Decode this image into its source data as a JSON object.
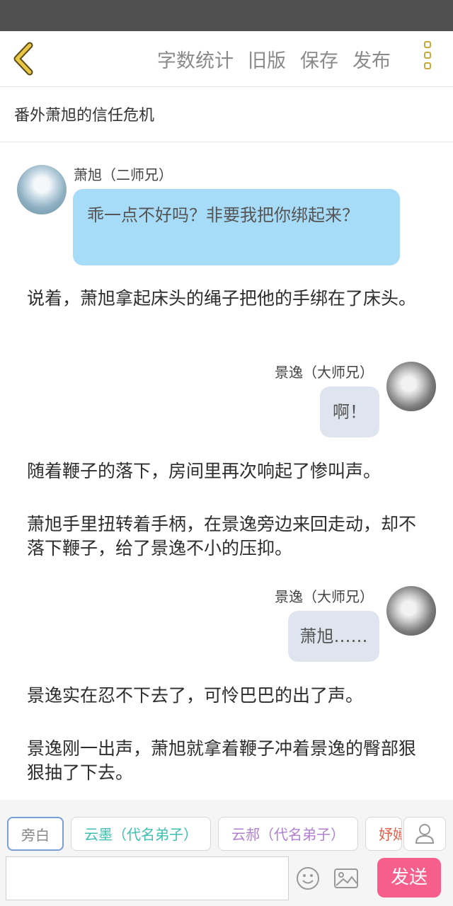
{
  "toolbar": {
    "word_count": "字数统计",
    "old_version": "旧版",
    "save": "保存",
    "publish": "发布"
  },
  "chapter": {
    "title": "番外萧旭的信任危机"
  },
  "messages": [
    {
      "type": "dialog",
      "speaker": "萧旭（二师兄）",
      "text": "乖一点不好吗？非要我把你绑起来？"
    },
    {
      "type": "narration",
      "text": "说着，萧旭拿起床头的绳子把他的手绑在了床头。"
    },
    {
      "type": "dialog",
      "speaker": "景逸（大师兄）",
      "text": "啊！"
    },
    {
      "type": "narration",
      "text": "随着鞭子的落下，房间里再次响起了惨叫声。"
    },
    {
      "type": "narration",
      "text": "萧旭手里扭转着手柄，在景逸旁边来回走动，却不落下鞭子，给了景逸不小的压抑。"
    },
    {
      "type": "dialog",
      "speaker": "景逸（大师兄）",
      "text": "萧旭……"
    },
    {
      "type": "narration",
      "text": "景逸实在忍不下去了，可怜巴巴的出了声。"
    },
    {
      "type": "narration",
      "text": "景逸刚一出声，萧旭就拿着鞭子冲着景逸的臀部狠狠抽了下去。"
    }
  ],
  "roles": {
    "narrator": "旁白",
    "items": [
      "云墨（代名弟子）",
      "云郝（代名弟子）",
      "妤嫣"
    ]
  },
  "composer": {
    "send": "发送",
    "placeholder": ""
  },
  "colors": {
    "accent": "#f65e8c",
    "bubble_left": "#a7dcf8",
    "bubble_right": "#dfe5ee",
    "icon_gold": "#caa93a"
  }
}
